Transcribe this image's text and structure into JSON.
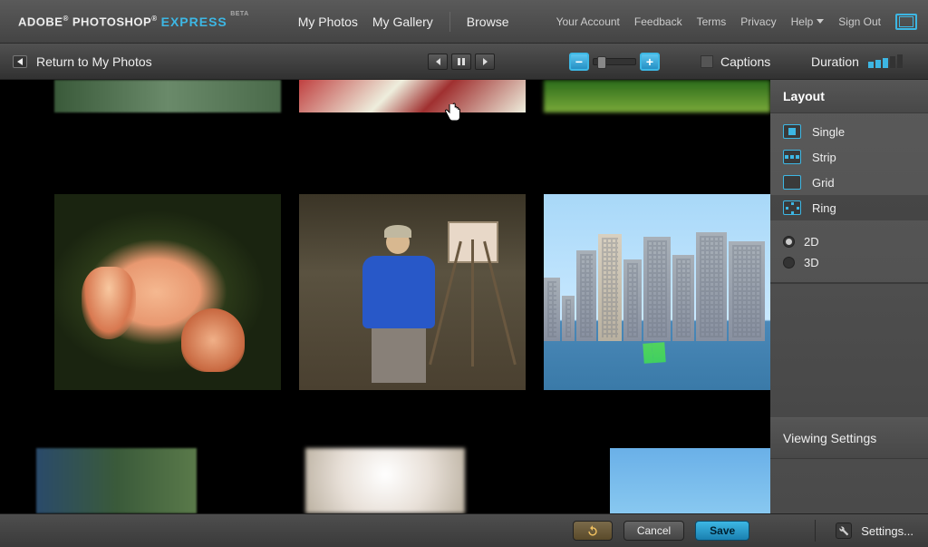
{
  "logo": {
    "adobe": "ADOBE",
    "photoshop": "PHOTOSHOP",
    "express": "EXPRESS",
    "beta": "BETA"
  },
  "mainNav": {
    "myPhotos": "My Photos",
    "myGallery": "My Gallery",
    "browse": "Browse"
  },
  "rightNav": {
    "account": "Your Account",
    "feedback": "Feedback",
    "terms": "Terms",
    "privacy": "Privacy",
    "help": "Help",
    "signOut": "Sign Out"
  },
  "toolbar": {
    "return": "Return to My Photos",
    "captions": "Captions",
    "duration": "Duration"
  },
  "sidebar": {
    "layoutHeader": "Layout",
    "layouts": {
      "single": "Single",
      "strip": "Strip",
      "grid": "Grid",
      "ring": "Ring"
    },
    "dims": {
      "d2": "2D",
      "d3": "3D"
    },
    "viewingSettings": "Viewing Settings"
  },
  "footer": {
    "cancel": "Cancel",
    "save": "Save",
    "settings": "Settings..."
  }
}
